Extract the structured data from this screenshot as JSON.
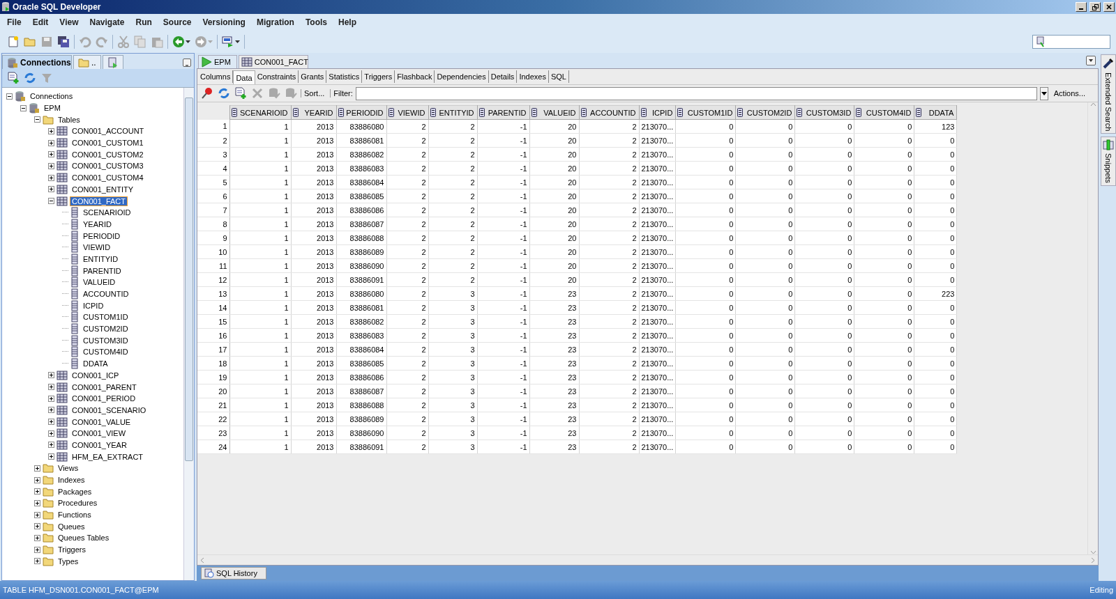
{
  "window": {
    "title": "Oracle SQL Developer"
  },
  "menu": [
    "File",
    "Edit",
    "View",
    "Navigate",
    "Run",
    "Source",
    "Versioning",
    "Migration",
    "Tools",
    "Help"
  ],
  "toolbar": [
    [
      {
        "kind": "new",
        "disabled": false
      },
      {
        "kind": "open",
        "disabled": false
      },
      {
        "kind": "save",
        "disabled": true
      },
      {
        "kind": "save-all",
        "disabled": false
      }
    ],
    [
      {
        "kind": "undo",
        "disabled": true
      },
      {
        "kind": "redo",
        "disabled": true
      }
    ],
    [
      {
        "kind": "cut",
        "disabled": true
      },
      {
        "kind": "copy",
        "disabled": true
      },
      {
        "kind": "paste",
        "disabled": true
      }
    ],
    [
      {
        "kind": "back",
        "disabled": false
      },
      {
        "kind": "forward",
        "disabled": true
      }
    ],
    [
      {
        "kind": "sql",
        "disabled": false
      }
    ]
  ],
  "left_panel": {
    "tabs": [
      {
        "label": "Connections",
        "kind": "connections",
        "selected": true
      },
      {
        "label": "..",
        "kind": "folder",
        "selected": false
      },
      {
        "kind": "reports",
        "selected": false
      }
    ],
    "actions": [
      {
        "kind": "add",
        "disabled": false
      },
      {
        "kind": "refresh",
        "disabled": false
      },
      {
        "kind": "filter",
        "disabled": true
      }
    ],
    "tree": [
      {
        "label": "Connections",
        "kind": "connections",
        "expanded": true,
        "selected": false,
        "children": [
          {
            "label": "EPM",
            "kind": "connection",
            "expanded": true,
            "selected": false,
            "children": [
              {
                "label": "Tables",
                "kind": "folder",
                "expanded": true,
                "selected": false,
                "children": [
                  {
                    "label": "CON001_ACCOUNT",
                    "kind": "table",
                    "expanded": false,
                    "selected": false
                  },
                  {
                    "label": "CON001_CUSTOM1",
                    "kind": "table",
                    "expanded": false,
                    "selected": false
                  },
                  {
                    "label": "CON001_CUSTOM2",
                    "kind": "table",
                    "expanded": false,
                    "selected": false
                  },
                  {
                    "label": "CON001_CUSTOM3",
                    "kind": "table",
                    "expanded": false,
                    "selected": false
                  },
                  {
                    "label": "CON001_CUSTOM4",
                    "kind": "table",
                    "expanded": false,
                    "selected": false
                  },
                  {
                    "label": "CON001_ENTITY",
                    "kind": "table",
                    "expanded": false,
                    "selected": false
                  },
                  {
                    "label": "CON001_FACT",
                    "kind": "table",
                    "expanded": true,
                    "selected": true,
                    "children": [
                      {
                        "label": "SCENARIOID",
                        "kind": "column",
                        "selected": false
                      },
                      {
                        "label": "YEARID",
                        "kind": "column",
                        "selected": false
                      },
                      {
                        "label": "PERIODID",
                        "kind": "column",
                        "selected": false
                      },
                      {
                        "label": "VIEWID",
                        "kind": "column",
                        "selected": false
                      },
                      {
                        "label": "ENTITYID",
                        "kind": "column",
                        "selected": false
                      },
                      {
                        "label": "PARENTID",
                        "kind": "column",
                        "selected": false
                      },
                      {
                        "label": "VALUEID",
                        "kind": "column",
                        "selected": false
                      },
                      {
                        "label": "ACCOUNTID",
                        "kind": "column",
                        "selected": false
                      },
                      {
                        "label": "ICPID",
                        "kind": "column",
                        "selected": false
                      },
                      {
                        "label": "CUSTOM1ID",
                        "kind": "column",
                        "selected": false
                      },
                      {
                        "label": "CUSTOM2ID",
                        "kind": "column",
                        "selected": false
                      },
                      {
                        "label": "CUSTOM3ID",
                        "kind": "column",
                        "selected": false
                      },
                      {
                        "label": "CUSTOM4ID",
                        "kind": "column",
                        "selected": false
                      },
                      {
                        "label": "DDATA",
                        "kind": "column",
                        "selected": false
                      }
                    ]
                  },
                  {
                    "label": "CON001_ICP",
                    "kind": "table",
                    "expanded": false,
                    "selected": false
                  },
                  {
                    "label": "CON001_PARENT",
                    "kind": "table",
                    "expanded": false,
                    "selected": false
                  },
                  {
                    "label": "CON001_PERIOD",
                    "kind": "table",
                    "expanded": false,
                    "selected": false
                  },
                  {
                    "label": "CON001_SCENARIO",
                    "kind": "table",
                    "expanded": false,
                    "selected": false
                  },
                  {
                    "label": "CON001_VALUE",
                    "kind": "table",
                    "expanded": false,
                    "selected": false
                  },
                  {
                    "label": "CON001_VIEW",
                    "kind": "table",
                    "expanded": false,
                    "selected": false
                  },
                  {
                    "label": "CON001_YEAR",
                    "kind": "table",
                    "expanded": false,
                    "selected": false
                  },
                  {
                    "label": "HFM_EA_EXTRACT",
                    "kind": "table",
                    "expanded": false,
                    "selected": false
                  }
                ]
              },
              {
                "label": "Views",
                "kind": "folder",
                "expanded": false,
                "selected": false
              },
              {
                "label": "Indexes",
                "kind": "folder",
                "expanded": false,
                "selected": false
              },
              {
                "label": "Packages",
                "kind": "folder",
                "expanded": false,
                "selected": false
              },
              {
                "label": "Procedures",
                "kind": "folder",
                "expanded": false,
                "selected": false
              },
              {
                "label": "Functions",
                "kind": "folder",
                "expanded": false,
                "selected": false
              },
              {
                "label": "Queues",
                "kind": "folder",
                "expanded": false,
                "selected": false
              },
              {
                "label": "Queues Tables",
                "kind": "folder",
                "expanded": false,
                "selected": false
              },
              {
                "label": "Triggers",
                "kind": "folder",
                "expanded": false,
                "selected": false
              },
              {
                "label": "Types",
                "kind": "folder",
                "expanded": false,
                "selected": false
              }
            ]
          }
        ]
      }
    ]
  },
  "editor": {
    "tabs": [
      {
        "label": "EPM",
        "kind": "worksheet",
        "selected": false
      },
      {
        "label": "CON001_FACT",
        "kind": "table",
        "selected": true
      }
    ],
    "subtabs": [
      {
        "label": "Columns",
        "selected": false
      },
      {
        "label": "Data",
        "selected": true
      },
      {
        "label": "Constraints",
        "selected": false
      },
      {
        "label": "Grants",
        "selected": false
      },
      {
        "label": "Statistics",
        "selected": false
      },
      {
        "label": "Triggers",
        "selected": false
      },
      {
        "label": "Flashback",
        "selected": false
      },
      {
        "label": "Dependencies",
        "selected": false
      },
      {
        "label": "Details",
        "selected": false
      },
      {
        "label": "Indexes",
        "selected": false
      },
      {
        "label": "SQL",
        "selected": false
      }
    ],
    "data_toolbar": {
      "actions": [
        {
          "kind": "pin",
          "disabled": false
        },
        {
          "kind": "refresh",
          "disabled": false
        },
        {
          "kind": "insert-row",
          "disabled": false
        },
        {
          "kind": "delete",
          "disabled": true
        },
        {
          "kind": "commit",
          "disabled": true
        },
        {
          "kind": "rollback",
          "disabled": true
        }
      ],
      "sort": "Sort...",
      "filter_label": "Filter:",
      "actions_button": "Actions..."
    },
    "table": {
      "columns": [
        {
          "label": "SCENARIOID",
          "kind": "number"
        },
        {
          "label": "YEARID",
          "kind": "number"
        },
        {
          "label": "PERIODID",
          "kind": "number"
        },
        {
          "label": "VIEWID",
          "kind": "number"
        },
        {
          "label": "ENTITYID",
          "kind": "number"
        },
        {
          "label": "PARENTID",
          "kind": "number"
        },
        {
          "label": "VALUEID",
          "kind": "number"
        },
        {
          "label": "ACCOUNTID",
          "kind": "number"
        },
        {
          "label": "ICPID",
          "kind": "text"
        },
        {
          "label": "CUSTOM1ID",
          "kind": "number"
        },
        {
          "label": "CUSTOM2ID",
          "kind": "number"
        },
        {
          "label": "CUSTOM3ID",
          "kind": "number"
        },
        {
          "label": "CUSTOM4ID",
          "kind": "number"
        },
        {
          "label": "DDATA",
          "kind": "number"
        }
      ],
      "rows": [
        {
          "number": "1",
          "cells": [
            "1",
            "2013",
            "83886080",
            "2",
            "2",
            "-1",
            "20",
            "2",
            "213070...",
            "0",
            "0",
            "0",
            "0",
            "123"
          ]
        },
        {
          "number": "2",
          "cells": [
            "1",
            "2013",
            "83886081",
            "2",
            "2",
            "-1",
            "20",
            "2",
            "213070...",
            "0",
            "0",
            "0",
            "0",
            "0"
          ]
        },
        {
          "number": "3",
          "cells": [
            "1",
            "2013",
            "83886082",
            "2",
            "2",
            "-1",
            "20",
            "2",
            "213070...",
            "0",
            "0",
            "0",
            "0",
            "0"
          ]
        },
        {
          "number": "4",
          "cells": [
            "1",
            "2013",
            "83886083",
            "2",
            "2",
            "-1",
            "20",
            "2",
            "213070...",
            "0",
            "0",
            "0",
            "0",
            "0"
          ]
        },
        {
          "number": "5",
          "cells": [
            "1",
            "2013",
            "83886084",
            "2",
            "2",
            "-1",
            "20",
            "2",
            "213070...",
            "0",
            "0",
            "0",
            "0",
            "0"
          ]
        },
        {
          "number": "6",
          "cells": [
            "1",
            "2013",
            "83886085",
            "2",
            "2",
            "-1",
            "20",
            "2",
            "213070...",
            "0",
            "0",
            "0",
            "0",
            "0"
          ]
        },
        {
          "number": "7",
          "cells": [
            "1",
            "2013",
            "83886086",
            "2",
            "2",
            "-1",
            "20",
            "2",
            "213070...",
            "0",
            "0",
            "0",
            "0",
            "0"
          ]
        },
        {
          "number": "8",
          "cells": [
            "1",
            "2013",
            "83886087",
            "2",
            "2",
            "-1",
            "20",
            "2",
            "213070...",
            "0",
            "0",
            "0",
            "0",
            "0"
          ]
        },
        {
          "number": "9",
          "cells": [
            "1",
            "2013",
            "83886088",
            "2",
            "2",
            "-1",
            "20",
            "2",
            "213070...",
            "0",
            "0",
            "0",
            "0",
            "0"
          ]
        },
        {
          "number": "10",
          "cells": [
            "1",
            "2013",
            "83886089",
            "2",
            "2",
            "-1",
            "20",
            "2",
            "213070...",
            "0",
            "0",
            "0",
            "0",
            "0"
          ]
        },
        {
          "number": "11",
          "cells": [
            "1",
            "2013",
            "83886090",
            "2",
            "2",
            "-1",
            "20",
            "2",
            "213070...",
            "0",
            "0",
            "0",
            "0",
            "0"
          ]
        },
        {
          "number": "12",
          "cells": [
            "1",
            "2013",
            "83886091",
            "2",
            "2",
            "-1",
            "20",
            "2",
            "213070...",
            "0",
            "0",
            "0",
            "0",
            "0"
          ]
        },
        {
          "number": "13",
          "cells": [
            "1",
            "2013",
            "83886080",
            "2",
            "3",
            "-1",
            "23",
            "2",
            "213070...",
            "0",
            "0",
            "0",
            "0",
            "223"
          ]
        },
        {
          "number": "14",
          "cells": [
            "1",
            "2013",
            "83886081",
            "2",
            "3",
            "-1",
            "23",
            "2",
            "213070...",
            "0",
            "0",
            "0",
            "0",
            "0"
          ]
        },
        {
          "number": "15",
          "cells": [
            "1",
            "2013",
            "83886082",
            "2",
            "3",
            "-1",
            "23",
            "2",
            "213070...",
            "0",
            "0",
            "0",
            "0",
            "0"
          ]
        },
        {
          "number": "16",
          "cells": [
            "1",
            "2013",
            "83886083",
            "2",
            "3",
            "-1",
            "23",
            "2",
            "213070...",
            "0",
            "0",
            "0",
            "0",
            "0"
          ]
        },
        {
          "number": "17",
          "cells": [
            "1",
            "2013",
            "83886084",
            "2",
            "3",
            "-1",
            "23",
            "2",
            "213070...",
            "0",
            "0",
            "0",
            "0",
            "0"
          ]
        },
        {
          "number": "18",
          "cells": [
            "1",
            "2013",
            "83886085",
            "2",
            "3",
            "-1",
            "23",
            "2",
            "213070...",
            "0",
            "0",
            "0",
            "0",
            "0"
          ]
        },
        {
          "number": "19",
          "cells": [
            "1",
            "2013",
            "83886086",
            "2",
            "3",
            "-1",
            "23",
            "2",
            "213070...",
            "0",
            "0",
            "0",
            "0",
            "0"
          ]
        },
        {
          "number": "20",
          "cells": [
            "1",
            "2013",
            "83886087",
            "2",
            "3",
            "-1",
            "23",
            "2",
            "213070...",
            "0",
            "0",
            "0",
            "0",
            "0"
          ]
        },
        {
          "number": "21",
          "cells": [
            "1",
            "2013",
            "83886088",
            "2",
            "3",
            "-1",
            "23",
            "2",
            "213070...",
            "0",
            "0",
            "0",
            "0",
            "0"
          ]
        },
        {
          "number": "22",
          "cells": [
            "1",
            "2013",
            "83886089",
            "2",
            "3",
            "-1",
            "23",
            "2",
            "213070...",
            "0",
            "0",
            "0",
            "0",
            "0"
          ]
        },
        {
          "number": "23",
          "cells": [
            "1",
            "2013",
            "83886090",
            "2",
            "3",
            "-1",
            "23",
            "2",
            "213070...",
            "0",
            "0",
            "0",
            "0",
            "0"
          ]
        },
        {
          "number": "24",
          "cells": [
            "1",
            "2013",
            "83886091",
            "2",
            "3",
            "-1",
            "23",
            "2",
            "213070...",
            "0",
            "0",
            "0",
            "0",
            "0"
          ]
        }
      ]
    },
    "bottom_tabs": [
      {
        "label": "SQL History",
        "selected": false
      }
    ]
  },
  "side_panels": [
    {
      "label": "Extended Search",
      "kind": "search"
    },
    {
      "label": "Snippets",
      "kind": "snippets"
    }
  ],
  "status_bar": {
    "left": "TABLE HFM_DSN001.CON001_FACT@EPM",
    "right": "Editing"
  }
}
